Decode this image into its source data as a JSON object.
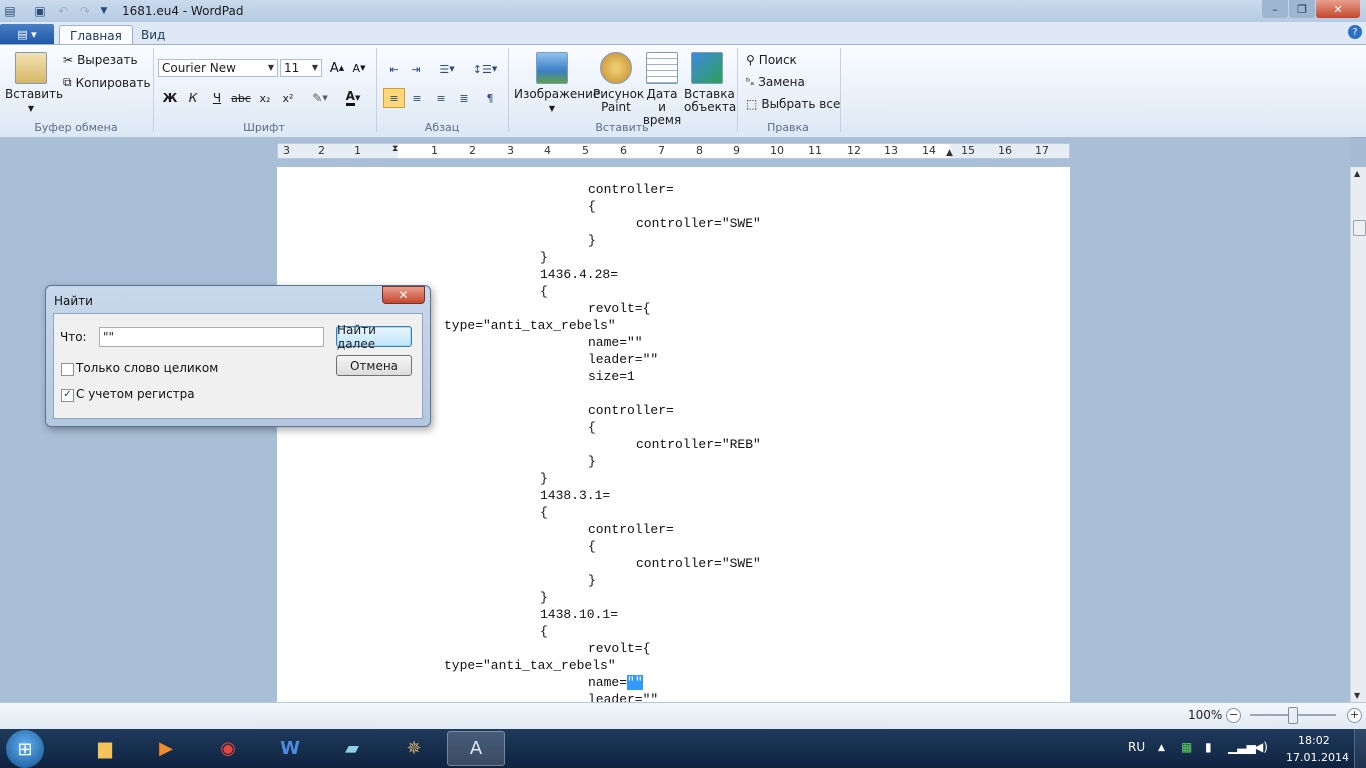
{
  "window": {
    "title": "1681.eu4 - WordPad"
  },
  "ribbon": {
    "tabs": [
      "Главная",
      "Вид"
    ],
    "clipboard": {
      "paste": "Вставить",
      "cut": "Вырезать",
      "copy": "Копировать",
      "group": "Буфер обмена"
    },
    "font": {
      "family": "Courier New",
      "size": "11",
      "group": "Шрифт",
      "bold": "Ж",
      "italic": "К",
      "underline": "Ч",
      "strike": "abc"
    },
    "paragraph": {
      "group": "Абзац"
    },
    "insert": {
      "picture": "Изображение",
      "paint1": "Рисунок",
      "paint2": "Paint",
      "date1": "Дата и",
      "date2": "время",
      "object1": "Вставка",
      "object2": "объекта",
      "group": "Вставить"
    },
    "edit": {
      "find": "Поиск",
      "replace": "Замена",
      "select_all": "Выбрать все",
      "group": "Правка"
    }
  },
  "ruler": {
    "ticks": [
      "3",
      "2",
      "1",
      "1",
      "2",
      "3",
      "4",
      "5",
      "6",
      "7",
      "8",
      "9",
      "10",
      "11",
      "12",
      "13",
      "14",
      "15",
      "16",
      "17"
    ]
  },
  "document": {
    "lines": [
      {
        "indent": 311,
        "text": "controller="
      },
      {
        "indent": 311,
        "text": "{"
      },
      {
        "indent": 359,
        "text": "controller=\"SWE\""
      },
      {
        "indent": 311,
        "text": "}"
      },
      {
        "indent": 263,
        "text": "}"
      },
      {
        "indent": 263,
        "text": "1436.4.28="
      },
      {
        "indent": 263,
        "text": "{"
      },
      {
        "indent": 311,
        "text": "revolt={"
      },
      {
        "indent": 167,
        "text": "type=\"anti_tax_rebels\""
      },
      {
        "indent": 311,
        "text": "name=\"\""
      },
      {
        "indent": 311,
        "text": "leader=\"\""
      },
      {
        "indent": 311,
        "text": "size=1"
      },
      {
        "indent": 311,
        "text": ""
      },
      {
        "indent": 311,
        "text": "controller="
      },
      {
        "indent": 311,
        "text": "{"
      },
      {
        "indent": 359,
        "text": "controller=\"REB\""
      },
      {
        "indent": 311,
        "text": "}"
      },
      {
        "indent": 263,
        "text": "}"
      },
      {
        "indent": 263,
        "text": "1438.3.1="
      },
      {
        "indent": 263,
        "text": "{"
      },
      {
        "indent": 311,
        "text": "controller="
      },
      {
        "indent": 311,
        "text": "{"
      },
      {
        "indent": 359,
        "text": "controller=\"SWE\""
      },
      {
        "indent": 311,
        "text": "}"
      },
      {
        "indent": 263,
        "text": "}"
      },
      {
        "indent": 263,
        "text": "1438.10.1="
      },
      {
        "indent": 263,
        "text": "{"
      },
      {
        "indent": 311,
        "text": "revolt={"
      },
      {
        "indent": 167,
        "text": "type=\"anti_tax_rebels\""
      },
      {
        "indent": 311,
        "text": "name=",
        "selected": "\"\""
      },
      {
        "indent": 311,
        "text": "leader=\"\""
      }
    ]
  },
  "status": {
    "zoom": "100%"
  },
  "find_dialog": {
    "title": "Найти",
    "what_label": "Что:",
    "what_value": "\"\"",
    "find_next": "Найти далее",
    "cancel": "Отмена",
    "whole_word": "Только слово целиком",
    "whole_word_checked": false,
    "match_case": "С учетом регистра",
    "match_case_checked": true
  },
  "taskbar": {
    "lang": "RU",
    "time": "18:02",
    "date": "17.01.2014"
  }
}
